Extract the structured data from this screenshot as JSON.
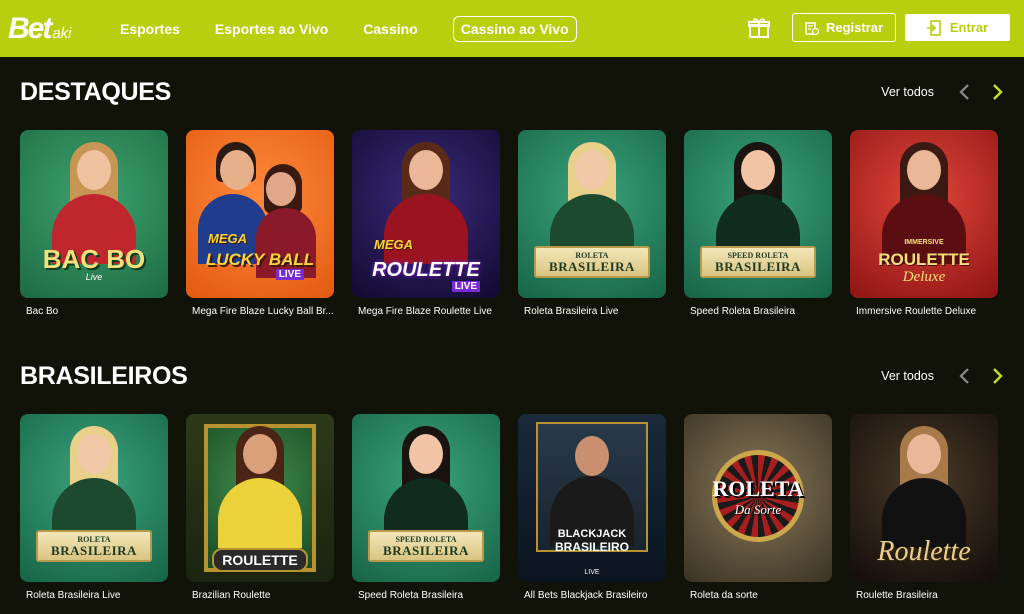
{
  "header": {
    "logo_main": "Bet",
    "logo_sub": "aki",
    "nav": [
      "Esportes",
      "Esportes ao Vivo",
      "Cassino",
      "Cassino ao Vivo"
    ],
    "register_label": "Registrar",
    "login_label": "Entrar"
  },
  "sections": [
    {
      "title": "DESTAQUES",
      "see_all": "Ver todos",
      "games": [
        {
          "name": "Bac Bo",
          "logo": "BAC BO",
          "sub": "Live"
        },
        {
          "name": "Mega Fire Blaze Lucky Ball Br...",
          "logo_top": "MEGA",
          "logo": "LUCKY BALL",
          "sub": "LIVE"
        },
        {
          "name": "Mega Fire Blaze Roulette Live",
          "logo_top": "MEGA",
          "logo": "ROULETTE",
          "sub": "LIVE"
        },
        {
          "name": "Roleta Brasileira Live",
          "plaque_small": "ROLETA",
          "plaque_big": "BRASILEIRA"
        },
        {
          "name": "Speed Roleta Brasileira",
          "plaque_small": "SPEED ROLETA",
          "plaque_big": "BRASILEIRA"
        },
        {
          "name": "Immersive Roulette Deluxe",
          "logo_top": "IMMERSIVE",
          "logo": "ROULETTE",
          "sub": "Deluxe"
        }
      ]
    },
    {
      "title": "BRASILEIROS",
      "see_all": "Ver todos",
      "games": [
        {
          "name": "Roleta Brasileira Live",
          "plaque_small": "ROLETA",
          "plaque_big": "BRASILEIRA"
        },
        {
          "name": "Brazilian Roulette",
          "logo": "ROULETTE"
        },
        {
          "name": "Speed Roleta Brasileira",
          "plaque_small": "SPEED ROLETA",
          "plaque_big": "BRASILEIRA"
        },
        {
          "name": "All Bets Blackjack Brasileiro",
          "logo_top": "BLACKJACK",
          "logo": "BRASILEIRO",
          "sub": "LIVE"
        },
        {
          "name": "Roleta da sorte",
          "logo": "ROLETA",
          "sub": "Da Sorte"
        },
        {
          "name": "Roulette Brasileira",
          "logo": "Roulette"
        }
      ]
    }
  ],
  "colors": {
    "brand": "#b8cf0f",
    "background": "#121308"
  }
}
